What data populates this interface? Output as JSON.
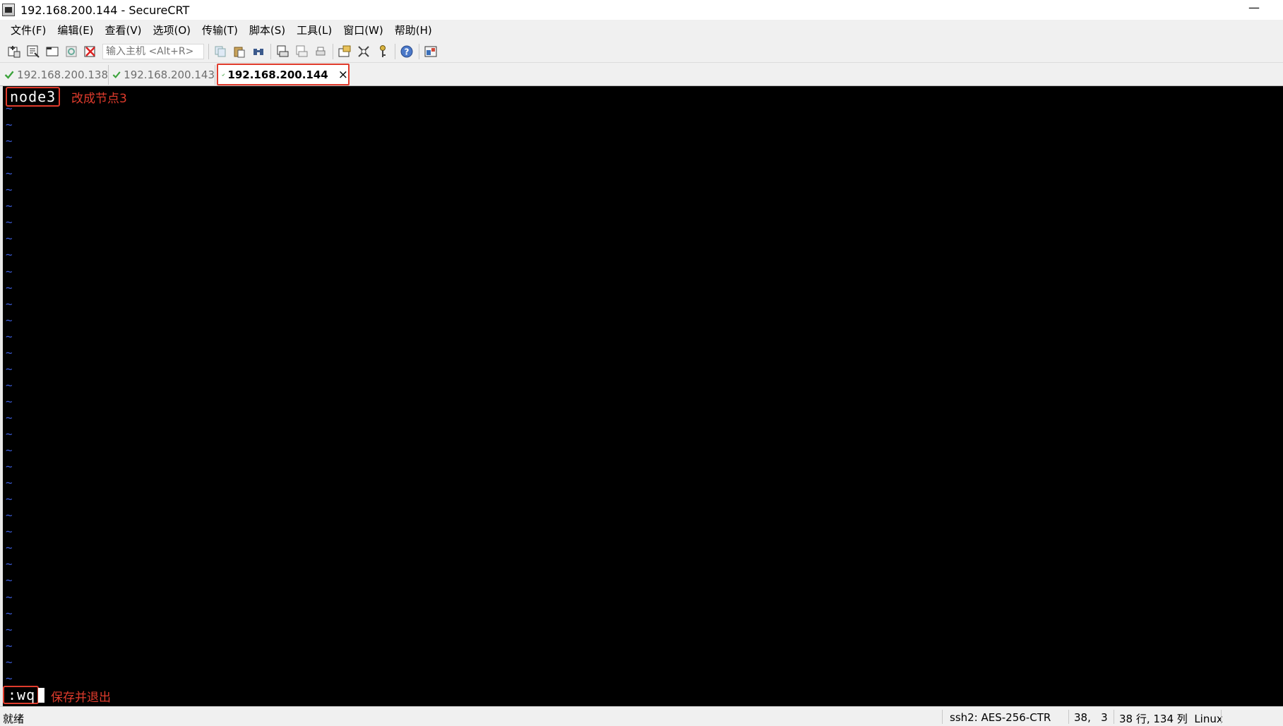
{
  "window": {
    "title": "192.168.200.144 - SecureCRT",
    "minimize_symbol": "—"
  },
  "menubar": {
    "items": [
      "文件(F)",
      "编辑(E)",
      "查看(V)",
      "选项(O)",
      "传输(T)",
      "脚本(S)",
      "工具(L)",
      "窗口(W)",
      "帮助(H)"
    ]
  },
  "toolbar": {
    "host_placeholder": "输入主机 <Alt+R>",
    "icons_group1": [
      "connect-icon",
      "quick-connect-icon",
      "connect-in-tab-icon",
      "reconnect-icon",
      "disconnect-icon"
    ],
    "icons_group2": [
      "copy-icon",
      "paste-icon",
      "find-icon",
      "print-icon",
      "print-selection-icon",
      "printer-icon",
      "session-options-icon",
      "global-options-icon",
      "key-icon",
      "help-icon",
      "sftp-icon"
    ]
  },
  "tabs": [
    {
      "label": "192.168.200.138",
      "active": false,
      "connected": true
    },
    {
      "label": "192.168.200.143",
      "active": false,
      "connected": true
    },
    {
      "label": "192.168.200.144",
      "active": true,
      "connected": true,
      "close": "×"
    }
  ],
  "terminal": {
    "first_line": "node3",
    "first_line_note": "改成节点3",
    "tilde_char": "~",
    "tilde_count": 36,
    "command": ":wq",
    "command_note": "保存并退出"
  },
  "statusbar": {
    "state": "就绪",
    "protocol": "ssh2: AES-256-CTR",
    "cursor_pos": "38,   3",
    "size": "38 行, 134 列  Linux"
  },
  "colors": {
    "annotation": "#e03b2c",
    "tilde": "#3b5bd6",
    "terminal_bg": "#000000",
    "check": "#3aa23a"
  }
}
